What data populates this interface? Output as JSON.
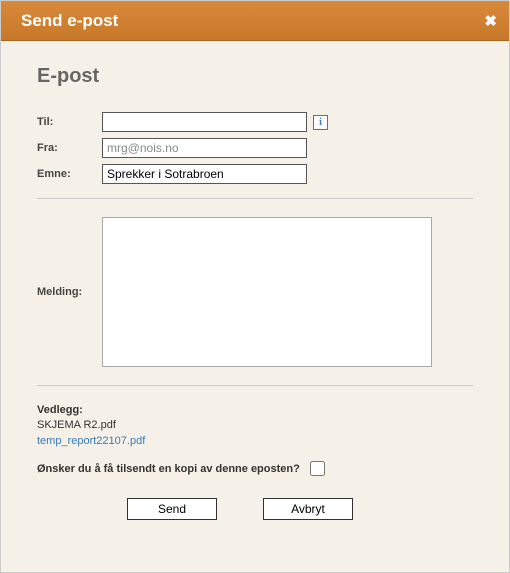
{
  "titlebar": {
    "title": "Send e-post"
  },
  "heading": "E-post",
  "fields": {
    "to": {
      "label": "Til:",
      "value": ""
    },
    "from": {
      "label": "Fra:",
      "value": "mrg@nois.no"
    },
    "subject": {
      "label": "Emne:",
      "value": "Sprekker i Sotrabroen"
    },
    "message": {
      "label": "Melding:",
      "value": ""
    }
  },
  "info_icon_glyph": "i",
  "attachments": {
    "label": "Vedlegg:",
    "items": [
      "SKJEMA R2.pdf"
    ],
    "links": [
      "temp_report22107.pdf"
    ]
  },
  "copy": {
    "label": "Ønsker du å få tilsendt en kopi av denne eposten?",
    "checked": false
  },
  "buttons": {
    "send": "Send",
    "cancel": "Avbryt"
  }
}
